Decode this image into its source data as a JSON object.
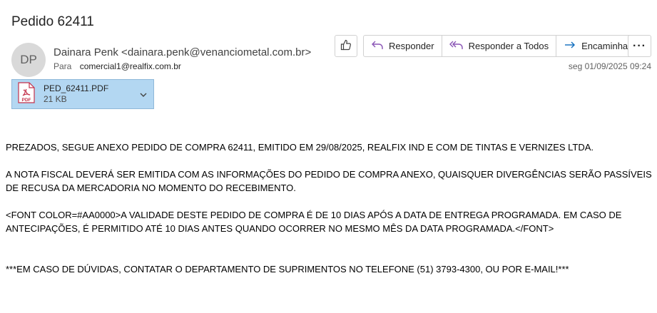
{
  "email": {
    "subject": "Pedido 62411",
    "avatar_initials": "DP",
    "from": "Dainara Penk <dainara.penk@venanciometal.com.br>",
    "to_label": "Para",
    "to_value": "comercial1@realfix.com.br",
    "date": "seg 01/09/2025 09:24"
  },
  "toolbar": {
    "like_icon": "thumbs-up-icon",
    "reply_label": "Responder",
    "reply_all_label": "Responder a Todos",
    "forward_label": "Encaminhar",
    "more_label": "···"
  },
  "attachment": {
    "name": "PED_62411.PDF",
    "size": "21 KB",
    "icon": "pdf-icon",
    "icon_label": "PDF"
  },
  "body": {
    "p1": "PREZADOS, SEGUE ANEXO PEDIDO DE COMPRA 62411, EMITIDO EM 29/08/2025, REALFIX IND E COM DE TINTAS E VERNIZES LTDA.",
    "p2": "A NOTA FISCAL DEVERÁ SER EMITIDA COM AS INFORMAÇÕES DO PEDIDO DE COMPRA ANEXO, QUAISQUER DIVERGÊNCIAS SERÃO PASSÍVEIS DE RECUSA DA MERCADORIA NO MOMENTO DO RECEBIMENTO.",
    "p3": "<FONT COLOR=#AA0000>A VALIDADE DESTE PEDIDO DE COMPRA É DE 10 DIAS APÓS A DATA DE ENTREGA PROGRAMADA. EM CASO DE ANTECIPAÇÕES, É PERMITIDO ATÉ 10 DIAS ANTES QUANDO OCORRER NO MESMO MÊS DA DATA PROGRAMADA.</FONT>",
    "p4": "***EM CASO DE DÚVIDAS, CONTATAR O DEPARTAMENTO DE SUPRIMENTOS NO TELEFONE (51) 3793-4300, OU POR E-MAIL!***"
  },
  "colors": {
    "accent": "#0f6cbd",
    "attachment_bg": "#b3d7f2",
    "pdf_red": "#c4314b"
  }
}
